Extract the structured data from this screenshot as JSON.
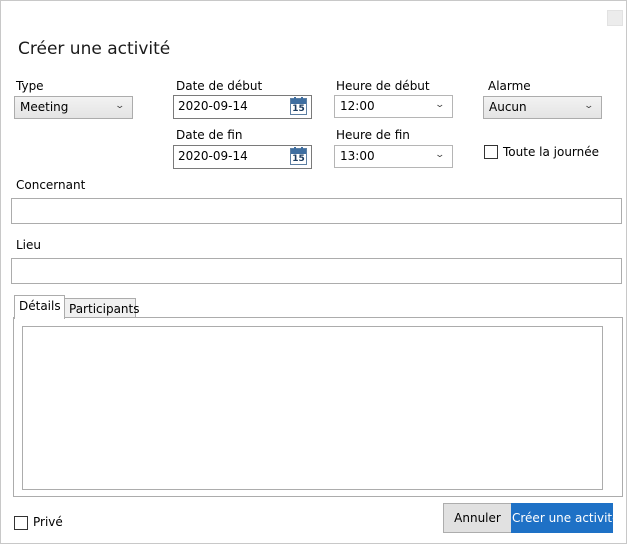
{
  "dialog": {
    "title": "Créer une activité"
  },
  "type": {
    "label": "Type",
    "value": "Meeting"
  },
  "start_date": {
    "label": "Date de début",
    "value": "2020-09-14",
    "calendar_day": "15"
  },
  "end_date": {
    "label": "Date de fin",
    "value": "2020-09-14",
    "calendar_day": "15"
  },
  "start_time": {
    "label": "Heure de début",
    "value": "12:00"
  },
  "end_time": {
    "label": "Heure de fin",
    "value": "13:00"
  },
  "alarm": {
    "label": "Alarme",
    "value": "Aucun"
  },
  "all_day": {
    "label": "Toute la journée",
    "checked": false
  },
  "regarding": {
    "label": "Concernant",
    "value": ""
  },
  "location": {
    "label": "Lieu",
    "value": ""
  },
  "tabs": [
    {
      "label": "Détails",
      "active": true
    },
    {
      "label": "Participants",
      "active": false
    }
  ],
  "private": {
    "label": "Privé",
    "checked": false
  },
  "buttons": {
    "cancel": "Annuler",
    "create": "Créer une activité"
  },
  "icons": {
    "dropdown": "chevron-down-icon",
    "calendar": "calendar-icon",
    "close": "close-icon"
  },
  "colors": {
    "primary": "#1e71c6",
    "border": "#acacac"
  }
}
